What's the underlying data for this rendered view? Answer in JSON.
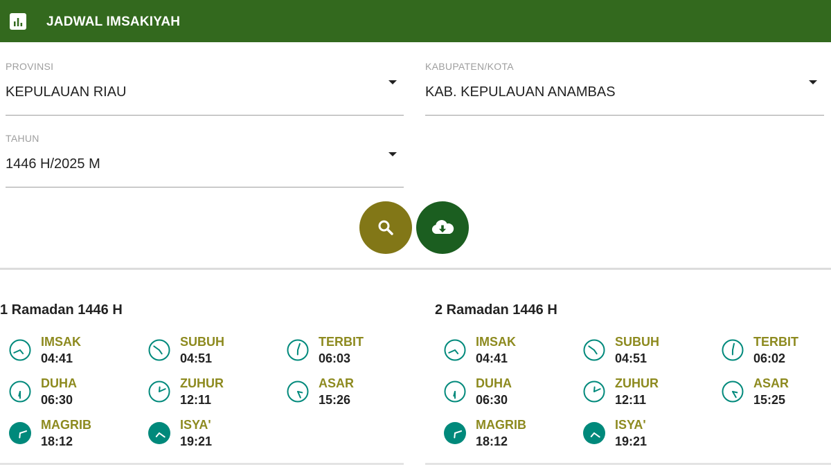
{
  "header": {
    "title": "JADWAL IMSAKIYAH",
    "icon": "bar-chart-icon"
  },
  "colors": {
    "header_bg": "#33691e",
    "search_button": "#827717",
    "download_button": "#1b5e20",
    "prayer_name": "#8d8a1f",
    "clock": "#00897b"
  },
  "form": {
    "provinsi": {
      "label": "PROVINSI",
      "value": "KEPULAUAN RIAU"
    },
    "kabupaten": {
      "label": "KABUPATEN/KOTA",
      "value": "KAB. KEPULAUAN ANAMBAS"
    },
    "tahun": {
      "label": "TAHUN",
      "value": "1446 H/2025 M"
    }
  },
  "actions": {
    "search_icon": "search-icon",
    "download_icon": "cloud-download-icon"
  },
  "days": [
    {
      "title": "1 Ramadan 1446 H",
      "times": [
        {
          "name": "IMSAK",
          "time": "04:41"
        },
        {
          "name": "SUBUH",
          "time": "04:51"
        },
        {
          "name": "TERBIT",
          "time": "06:03"
        },
        {
          "name": "DUHA",
          "time": "06:30"
        },
        {
          "name": "ZUHUR",
          "time": "12:11"
        },
        {
          "name": "ASAR",
          "time": "15:26"
        },
        {
          "name": "MAGRIB",
          "time": "18:12"
        },
        {
          "name": "ISYA'",
          "time": "19:21"
        }
      ]
    },
    {
      "title": "2 Ramadan 1446 H",
      "times": [
        {
          "name": "IMSAK",
          "time": "04:41"
        },
        {
          "name": "SUBUH",
          "time": "04:51"
        },
        {
          "name": "TERBIT",
          "time": "06:02"
        },
        {
          "name": "DUHA",
          "time": "06:30"
        },
        {
          "name": "ZUHUR",
          "time": "12:11"
        },
        {
          "name": "ASAR",
          "time": "15:25"
        },
        {
          "name": "MAGRIB",
          "time": "18:12"
        },
        {
          "name": "ISYA'",
          "time": "19:21"
        }
      ]
    }
  ]
}
